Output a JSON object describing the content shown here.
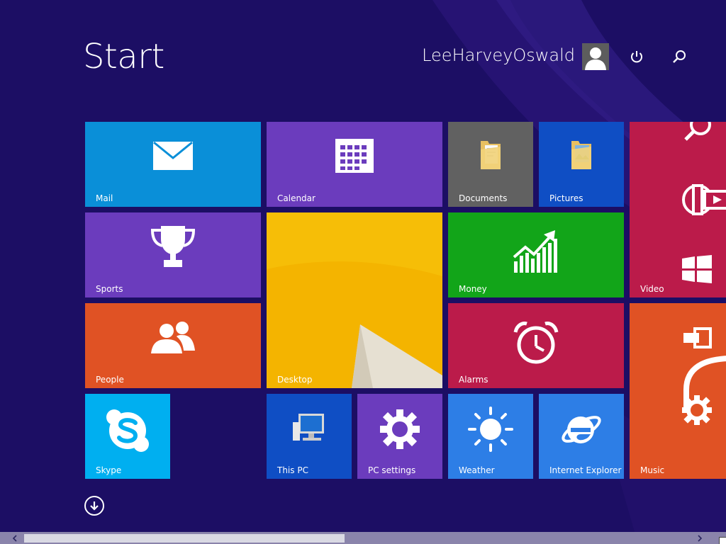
{
  "header": {
    "title": "Start",
    "user_name": "LeeHarveyOswald",
    "power_icon": "power-icon",
    "search_icon": "search-icon"
  },
  "tiles": {
    "mail": {
      "label": "Mail",
      "icon": "envelope-icon",
      "color": "#0a8fd8"
    },
    "calendar": {
      "label": "Calendar",
      "icon": "calendar-icon",
      "color": "#6b3cbd"
    },
    "documents": {
      "label": "Documents",
      "icon": "folder-icon",
      "color": "#616161"
    },
    "pictures": {
      "label": "Pictures",
      "icon": "folder-icon",
      "color": "#0f4ec4"
    },
    "video": {
      "label": "Video",
      "icon": "video-icon",
      "color": "#bb1b4a"
    },
    "sports": {
      "label": "Sports",
      "icon": "trophy-icon",
      "color": "#6b3cbd"
    },
    "desktop": {
      "label": "Desktop",
      "color": "#f2b300"
    },
    "money": {
      "label": "Money",
      "icon": "chart-up-icon",
      "color": "#12a519"
    },
    "people": {
      "label": "People",
      "icon": "people-icon",
      "color": "#e05224"
    },
    "alarms": {
      "label": "Alarms",
      "icon": "alarm-clock-icon",
      "color": "#bb1b4a"
    },
    "music": {
      "label": "Music",
      "icon": "headphones-icon",
      "color": "#e05224"
    },
    "skype": {
      "label": "Skype",
      "icon": "skype-icon",
      "color": "#00aff0"
    },
    "this_pc": {
      "label": "This PC",
      "icon": "computer-icon",
      "color": "#0f4ec4"
    },
    "pc_settings": {
      "label": "PC settings",
      "icon": "gear-icon",
      "color": "#6b3cbd"
    },
    "weather": {
      "label": "Weather",
      "icon": "sun-icon",
      "color": "#2d7ee6"
    },
    "internet_explorer": {
      "label": "Internet Explorer",
      "icon": "ie-icon",
      "color": "#2d7ee6"
    }
  },
  "footer": {
    "apps_button": "down-arrow-icon"
  },
  "scrollbar": {
    "position": 0.0
  }
}
